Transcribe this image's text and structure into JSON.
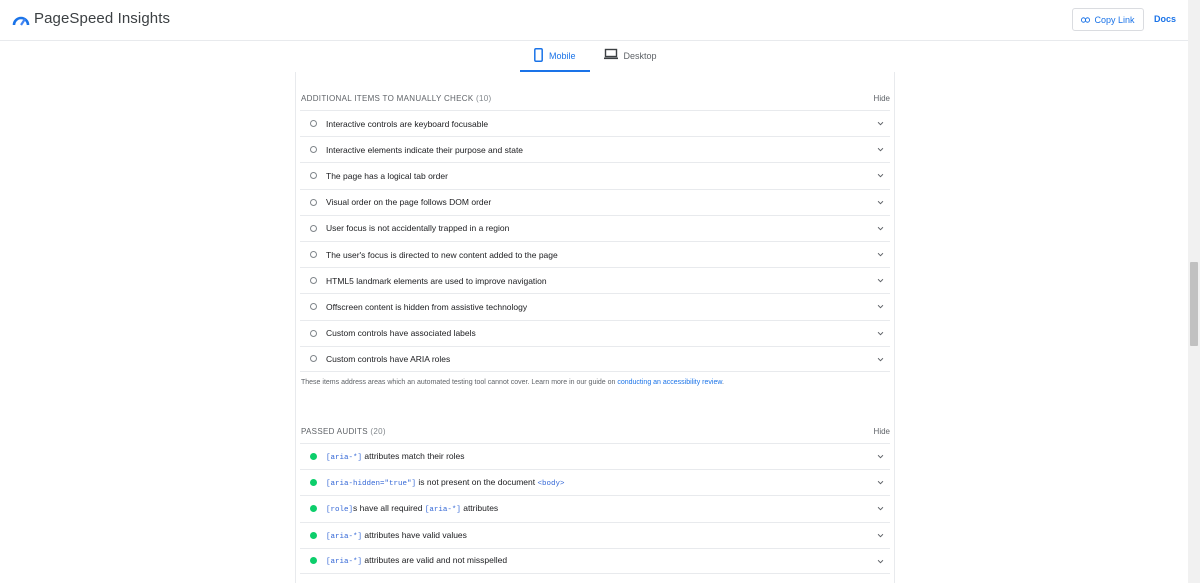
{
  "app": {
    "title": "PageSpeed Insights"
  },
  "header": {
    "copy_link": "Copy Link",
    "docs": "Docs"
  },
  "tabs": [
    {
      "label": "Mobile",
      "icon": "smartphone-icon",
      "active": true
    },
    {
      "label": "Desktop",
      "icon": "laptop-icon",
      "active": false
    }
  ],
  "manual": {
    "title": "ADDITIONAL ITEMS TO MANUALLY CHECK",
    "count": "(10)",
    "hide": "Hide",
    "items": [
      "Interactive controls are keyboard focusable",
      "Interactive elements indicate their purpose and state",
      "The page has a logical tab order",
      "Visual order on the page follows DOM order",
      "User focus is not accidentally trapped in a region",
      "The user's focus is directed to new content added to the page",
      "HTML5 landmark elements are used to improve navigation",
      "Offscreen content is hidden from assistive technology",
      "Custom controls have associated labels",
      "Custom controls have ARIA roles"
    ],
    "note_text": "These items address areas which an automated testing tool cannot cover. Learn more in our guide on ",
    "note_link": "conducting an accessibility review",
    "note_end": "."
  },
  "passed": {
    "title": "PASSED AUDITS",
    "count": "(20)",
    "hide": "Hide",
    "items": [
      {
        "code1": "[aria-*]",
        "text1": " attributes match their roles",
        "code2": "",
        "text2": ""
      },
      {
        "code1": "[aria-hidden=\"true\"]",
        "text1": " is not present on the document ",
        "code2": "<body>",
        "text2": ""
      },
      {
        "code1": "[role]",
        "text1": "s have all required ",
        "code2": "[aria-*]",
        "text2": " attributes"
      },
      {
        "code1": "[aria-*]",
        "text1": " attributes have valid values",
        "code2": "",
        "text2": ""
      },
      {
        "code1": "[aria-*]",
        "text1": " attributes are valid and not misspelled",
        "code2": "",
        "text2": ""
      }
    ]
  },
  "colors": {
    "accent": "#1a73e8",
    "pass": "#0cce6b",
    "code": "#3367d6"
  }
}
